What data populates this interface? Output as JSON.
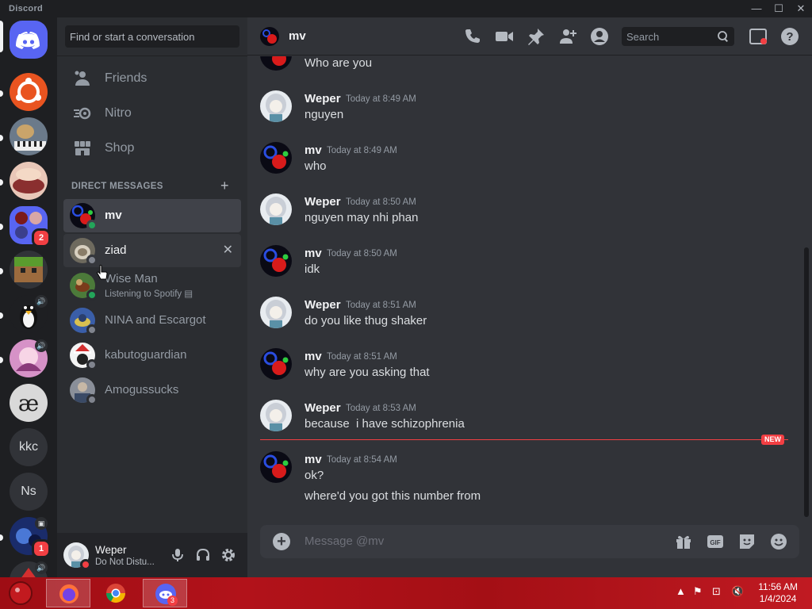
{
  "window": {
    "app_name": "Discord",
    "min": "—",
    "max": "☐",
    "close": "✕"
  },
  "servers": {
    "badge_four": "2",
    "badge_eleven": "1",
    "text_server_1": "kkc",
    "text_server_2": "Ns"
  },
  "sidebar": {
    "search_placeholder": "Find or start a conversation",
    "nav": [
      {
        "label": "Friends",
        "icon": "friends-icon"
      },
      {
        "label": "Nitro",
        "icon": "nitro-icon"
      },
      {
        "label": "Shop",
        "icon": "shop-icon"
      }
    ],
    "dm_header": "DIRECT MESSAGES",
    "dm_add": "+",
    "dms": [
      {
        "name": "mv",
        "status": "online"
      },
      {
        "name": "ziad",
        "status": "offline"
      },
      {
        "name": "Wise Man",
        "sub": "Listening to Spotify",
        "status": "online"
      },
      {
        "name": "NINA and Escargot",
        "status": "offline"
      },
      {
        "name": "kabutoguardian",
        "status": "offline"
      },
      {
        "name": "Amogussucks",
        "status": "offline"
      }
    ],
    "close_dm": "✕"
  },
  "user_panel": {
    "name": "Weper",
    "status": "Do Not Distu..."
  },
  "channel": {
    "title": "mv",
    "search_placeholder": "Search"
  },
  "messages": [
    {
      "body": "Who are you"
    },
    {
      "author": "Weper",
      "time": "Today at 8:49 AM",
      "body": "nguyen"
    },
    {
      "author": "mv",
      "time": "Today at 8:49 AM",
      "body": "who"
    },
    {
      "author": "Weper",
      "time": "Today at 8:50 AM",
      "body": "nguyen may nhi phan"
    },
    {
      "author": "mv",
      "time": "Today at 8:50 AM",
      "body": "idk"
    },
    {
      "author": "Weper",
      "time": "Today at 8:51 AM",
      "body": "do you like thug shaker"
    },
    {
      "author": "mv",
      "time": "Today at 8:51 AM",
      "body": "why are you asking that"
    },
    {
      "author": "Weper",
      "time": "Today at 8:53 AM",
      "body": "because  i have schizophrenia"
    },
    {
      "author": "mv",
      "time": "Today at 8:54 AM",
      "body": "ok?",
      "followup": "where'd you got this number from"
    }
  ],
  "new_divider": "NEW",
  "composer": {
    "placeholder": "Message @mv"
  },
  "taskbar": {
    "time": "11:56 AM",
    "date": "1/4/2024",
    "discord_badge": "3"
  },
  "colors": {
    "blurple": "#5865f2",
    "online": "#23a55a",
    "dnd": "#f23f43",
    "bg_main": "#313338",
    "bg_sidebar": "#2b2d31"
  }
}
